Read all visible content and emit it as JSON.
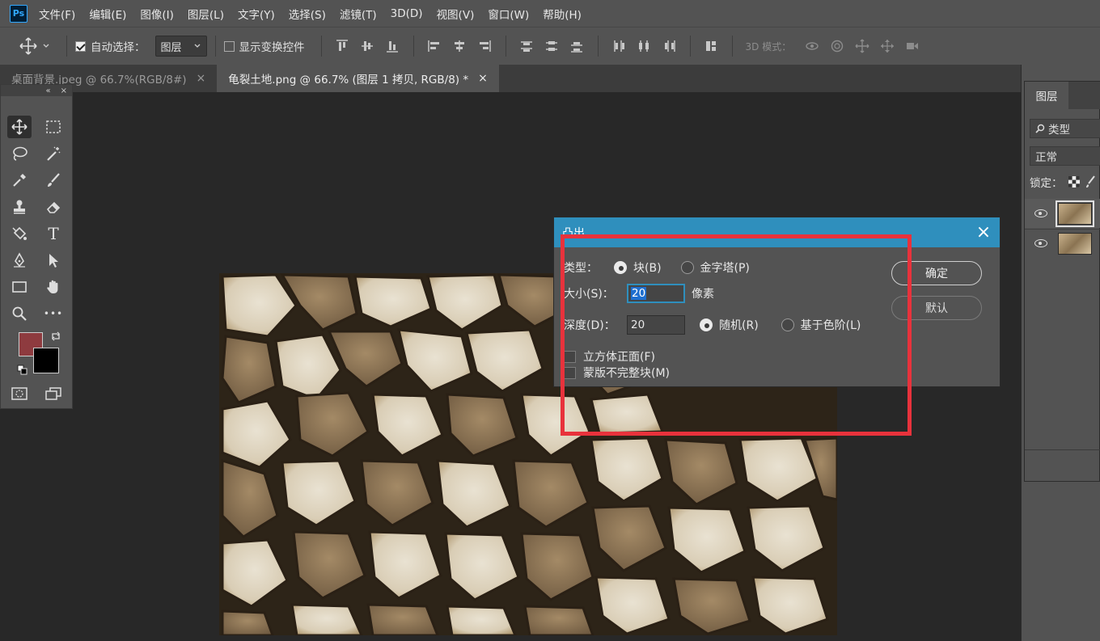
{
  "menubar": {
    "logo": "Ps",
    "items": [
      "文件(F)",
      "编辑(E)",
      "图像(I)",
      "图层(L)",
      "文字(Y)",
      "选择(S)",
      "滤镜(T)",
      "3D(D)",
      "视图(V)",
      "窗口(W)",
      "帮助(H)"
    ]
  },
  "options": {
    "auto_select_label": "自动选择：",
    "auto_select_checked": true,
    "auto_select_value": "图层",
    "show_transform_label": "显示变换控件",
    "show_transform_checked": false,
    "mode_3d_label": "3D 模式："
  },
  "tabs": [
    {
      "label": "桌面背景.jpeg @ 66.7%(RGB/8#)",
      "close": "×",
      "active": false
    },
    {
      "label": "龟裂土地.png @ 66.7% (图层 1 拷贝, RGB/8) *",
      "close": "×",
      "active": true
    }
  ],
  "toolbox": {
    "header_close": "×",
    "header_collapse": "«",
    "type_tool_glyph": "T",
    "more_tools_glyph": "•••",
    "foreground_color": "#8e3b3f",
    "background_color": "#000000"
  },
  "layers_panel": {
    "tab_label": "图层",
    "filter_label": "类型",
    "blend_mode": "正常",
    "lock_label": "锁定："
  },
  "dialog": {
    "title": "凸出",
    "close": "×",
    "type_label": "类型：",
    "type_options": [
      {
        "label": "块(B)",
        "selected": true
      },
      {
        "label": "金字塔(P)",
        "selected": false
      }
    ],
    "size_label": "大小(S)：",
    "size_value": "20",
    "size_unit": "像素",
    "depth_label": "深度(D)：",
    "depth_value": "20",
    "depth_options": [
      {
        "label": "随机(R)",
        "selected": true
      },
      {
        "label": "基于色阶(L)",
        "selected": false
      }
    ],
    "checkboxes": [
      {
        "label": "立方体正面(F)",
        "checked": false
      },
      {
        "label": "蒙版不完整块(M)",
        "checked": false
      }
    ],
    "ok_label": "确定",
    "default_label": "默认"
  },
  "colors": {
    "highlight_box": "#e8323c",
    "dialog_title_bar": "#2f8fbd"
  }
}
